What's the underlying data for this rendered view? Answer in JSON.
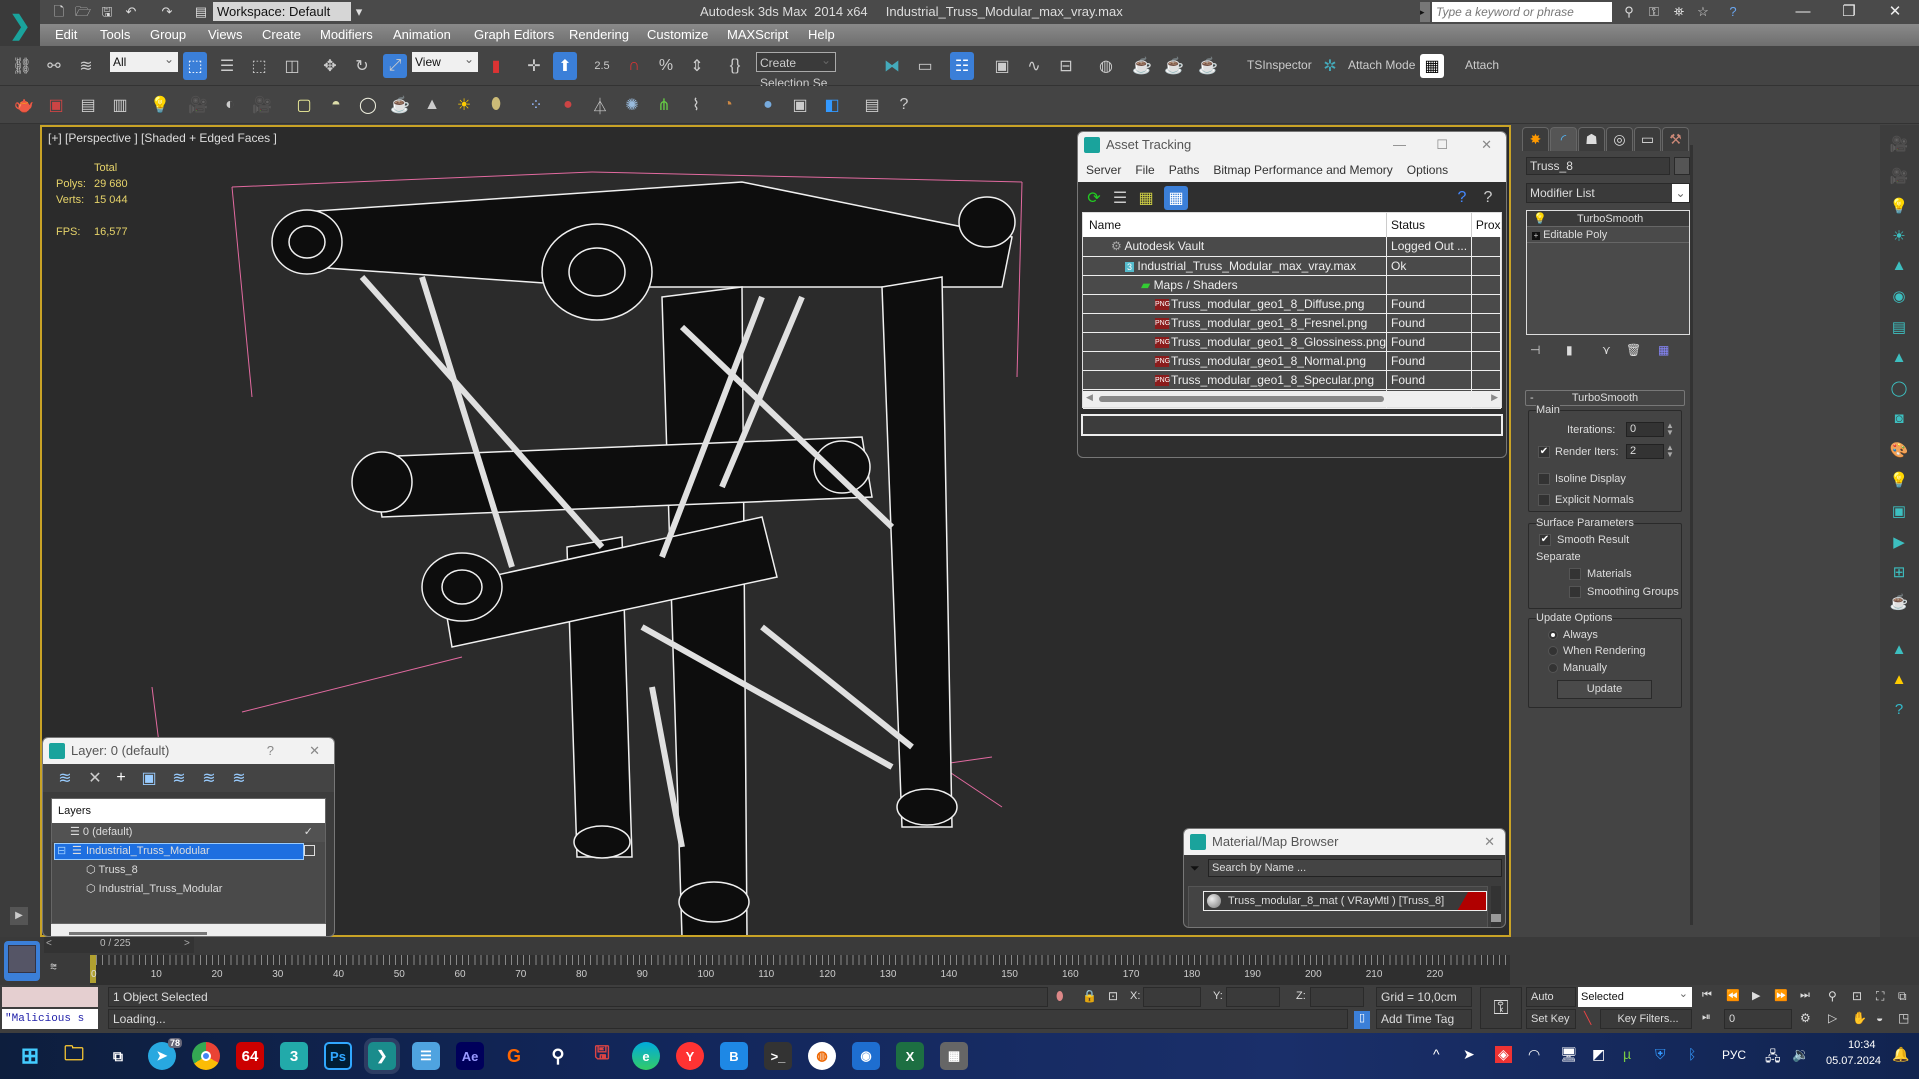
{
  "window": {
    "app_name": "Autodesk 3ds Max  2014 x64",
    "file_name": "Industrial_Truss_Modular_max_vray.max",
    "workspace": "Workspace: Default",
    "search_placeholder": "Type a keyword or phrase",
    "controls": [
      "—",
      "❐",
      "✕"
    ]
  },
  "menubar": [
    "Edit",
    "Tools",
    "Group",
    "Views",
    "Create",
    "Modifiers",
    "Animation",
    "Graph Editors",
    "Rendering",
    "Customize",
    "MAXScript",
    "Help"
  ],
  "main_toolbar": {
    "selection_filter": "All",
    "reference_coord": "View",
    "named_selection_placeholder": "Create Selection Se",
    "spinner_snap": "2.5",
    "ts_inspector": "TSInspector",
    "attach_mode": "Attach Mode",
    "attach": "Attach"
  },
  "viewport": {
    "label": "[+] [Perspective ] [Shaded + Edged Faces ]",
    "stats": {
      "total_label": "Total",
      "polys_label": "Polys:",
      "polys": "29 680",
      "verts_label": "Verts:",
      "verts": "15 044",
      "fps_label": "FPS:",
      "fps": "16,577"
    }
  },
  "asset_tracking": {
    "title": "Asset Tracking",
    "menu": [
      "Server",
      "File",
      "Paths",
      "Bitmap Performance and Memory",
      "Options"
    ],
    "columns": [
      "Name",
      "Status",
      "Prox"
    ],
    "rows": [
      {
        "name": "Autodesk Vault",
        "status": "Logged Out ...",
        "icon": "vault-icon",
        "indent": 1
      },
      {
        "name": "Industrial_Truss_Modular_max_vray.max",
        "status": "Ok",
        "icon": "max-file-icon",
        "indent": 2
      },
      {
        "name": "Maps / Shaders",
        "status": "",
        "icon": "maps-icon",
        "indent": 3
      },
      {
        "name": "Truss_modular_geo1_8_Diffuse.png",
        "status": "Found",
        "icon": "png-icon",
        "indent": 4
      },
      {
        "name": "Truss_modular_geo1_8_Fresnel.png",
        "status": "Found",
        "icon": "png-icon",
        "indent": 4
      },
      {
        "name": "Truss_modular_geo1_8_Glossiness.png",
        "status": "Found",
        "icon": "png-icon",
        "indent": 4
      },
      {
        "name": "Truss_modular_geo1_8_Normal.png",
        "status": "Found",
        "icon": "png-icon",
        "indent": 4
      },
      {
        "name": "Truss_modular_geo1_8_Specular.png",
        "status": "Found",
        "icon": "png-icon",
        "indent": 4
      }
    ]
  },
  "command_panel": {
    "object_name": "Truss_8",
    "modifier_list": "Modifier List",
    "stack": [
      "TurboSmooth",
      "Editable Poly"
    ],
    "turbosmooth": {
      "title": "TurboSmooth",
      "main_label": "Main",
      "iterations_label": "Iterations:",
      "iterations": "0",
      "render_iters_label": "Render Iters:",
      "render_iters": "2",
      "render_iters_checked": true,
      "isoline_label": "Isoline Display",
      "explicit_normals_label": "Explicit Normals",
      "surface_label": "Surface Parameters",
      "smooth_result_label": "Smooth Result",
      "separate_label": "Separate",
      "materials_label": "Materials",
      "smoothing_groups_label": "Smoothing Groups",
      "update_options_label": "Update Options",
      "always_label": "Always",
      "when_rendering_label": "When Rendering",
      "manually_label": "Manually",
      "update_button": "Update",
      "update_mode": "Always"
    }
  },
  "layer_dialog": {
    "title": "Layer: 0 (default)",
    "help": "?",
    "header": "Layers",
    "items": [
      {
        "label": "0 (default)",
        "type": "layer",
        "current": true
      },
      {
        "label": "Industrial_Truss_Modular",
        "type": "layer",
        "selected": true
      },
      {
        "label": "Truss_8",
        "type": "object"
      },
      {
        "label": "Industrial_Truss_Modular",
        "type": "object"
      }
    ]
  },
  "material_browser": {
    "title": "Material/Map Browser",
    "search_placeholder": "Search by Name ...",
    "item": "Truss_modular_8_mat  ( VRayMtl ) [Truss_8]",
    "accent": "#b00000"
  },
  "timeline": {
    "frame_display": "0 / 225",
    "prev": "<",
    "next": ">",
    "current_frame": "0",
    "ticks": [
      "10",
      "20",
      "30",
      "40",
      "50",
      "60",
      "70",
      "80",
      "90",
      "100",
      "110",
      "120",
      "130",
      "140",
      "150",
      "160",
      "170",
      "180",
      "190",
      "200",
      "210",
      "220"
    ]
  },
  "status_bar": {
    "maxscript_text": "\"Malicious s",
    "selection": "1 Object Selected",
    "prompt": "Loading...",
    "x_label": "X:",
    "y_label": "Y:",
    "z_label": "Z:",
    "grid": "Grid = 10,0cm",
    "add_time_tag": "Add Time Tag",
    "auto_key": "Auto Key",
    "set_key": "Set Key",
    "key_mode": "Selected",
    "key_filters": "Key Filters...",
    "frame_field": "0"
  },
  "taskbar": {
    "apps": [
      "windows-start",
      "file-explorer",
      "task-view",
      "telegram",
      "chrome",
      "aida64",
      "3ds-max-2014",
      "photoshop",
      "3ds-max",
      "notepad",
      "after-effects",
      "grammarly",
      "rsearch",
      "save",
      "edge",
      "yandex",
      "bitrix",
      "terminal",
      "openvpn",
      "greenshot",
      "excel",
      "calculator"
    ],
    "lang": "РУС",
    "time": "10:34",
    "date": "05.07.2024",
    "telegram_badge": "78",
    "aida_label": "64"
  }
}
